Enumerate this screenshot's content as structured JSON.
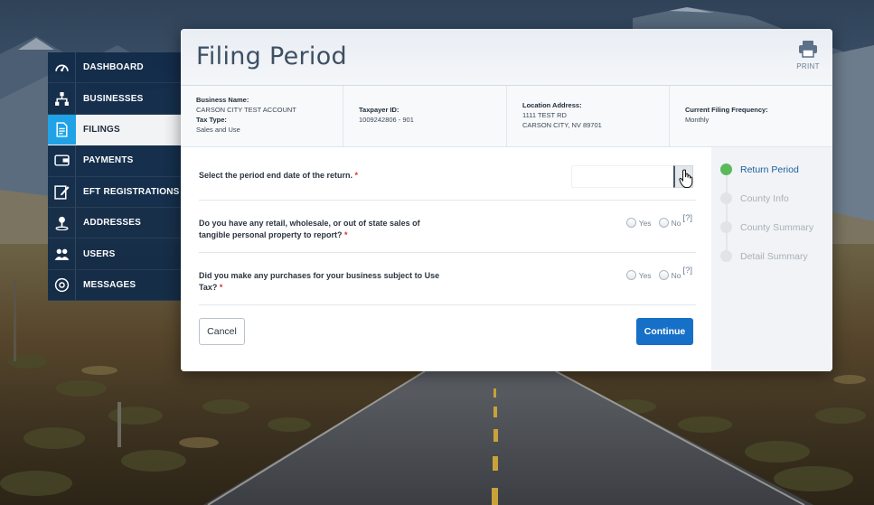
{
  "sidebar": {
    "items": [
      {
        "label": "DASHBOARD",
        "icon": "dashboard-gauge-icon"
      },
      {
        "label": "BUSINESSES",
        "icon": "org-chart-icon"
      },
      {
        "label": "FILINGS",
        "icon": "document-icon",
        "active": true
      },
      {
        "label": "PAYMENTS",
        "icon": "wallet-icon"
      },
      {
        "label": "EFT REGISTRATIONS",
        "icon": "edit-form-icon"
      },
      {
        "label": "ADDRESSES",
        "icon": "map-pin-icon"
      },
      {
        "label": "USERS",
        "icon": "users-icon"
      },
      {
        "label": "MESSAGES",
        "icon": "at-sign-icon"
      }
    ]
  },
  "modal": {
    "title": "Filing Period",
    "print_label": "PRINT"
  },
  "info": {
    "business_name_label": "Business Name:",
    "business_name": "CARSON CITY TEST ACCOUNT",
    "tax_type_label": "Tax Type:",
    "tax_type": "Sales and Use",
    "taxpayer_id_label": "Taxpayer ID:",
    "taxpayer_id": "1009242806 - 901",
    "location_label": "Location Address:",
    "location_line1": "1111 TEST RD",
    "location_line2": "CARSON CITY, NV 89701",
    "frequency_label": "Current Filing Frequency:",
    "frequency": "Monthly"
  },
  "form": {
    "q1": "Select the period end date of the return.",
    "q1_value": "",
    "q2_line1": "Do you have any retail, wholesale, or out of state sales of",
    "q2_line2": "tangible personal property to report?",
    "q3_line1": "Did you make any purchases for your business subject to Use",
    "q3_line2": "Tax?",
    "required_mark": "*",
    "yes": "Yes",
    "no": "No",
    "help": "[?]",
    "cancel": "Cancel",
    "continue": "Continue"
  },
  "steps": [
    {
      "label": "Return Period",
      "active": true
    },
    {
      "label": "County Info",
      "active": false
    },
    {
      "label": "County Summary",
      "active": false
    },
    {
      "label": "Detail Summary",
      "active": false
    }
  ],
  "colors": {
    "accent": "#1770c7",
    "active_step": "#5cb85c",
    "nav_bg": "#102a48",
    "nav_active_icon": "#1fa3e6"
  }
}
